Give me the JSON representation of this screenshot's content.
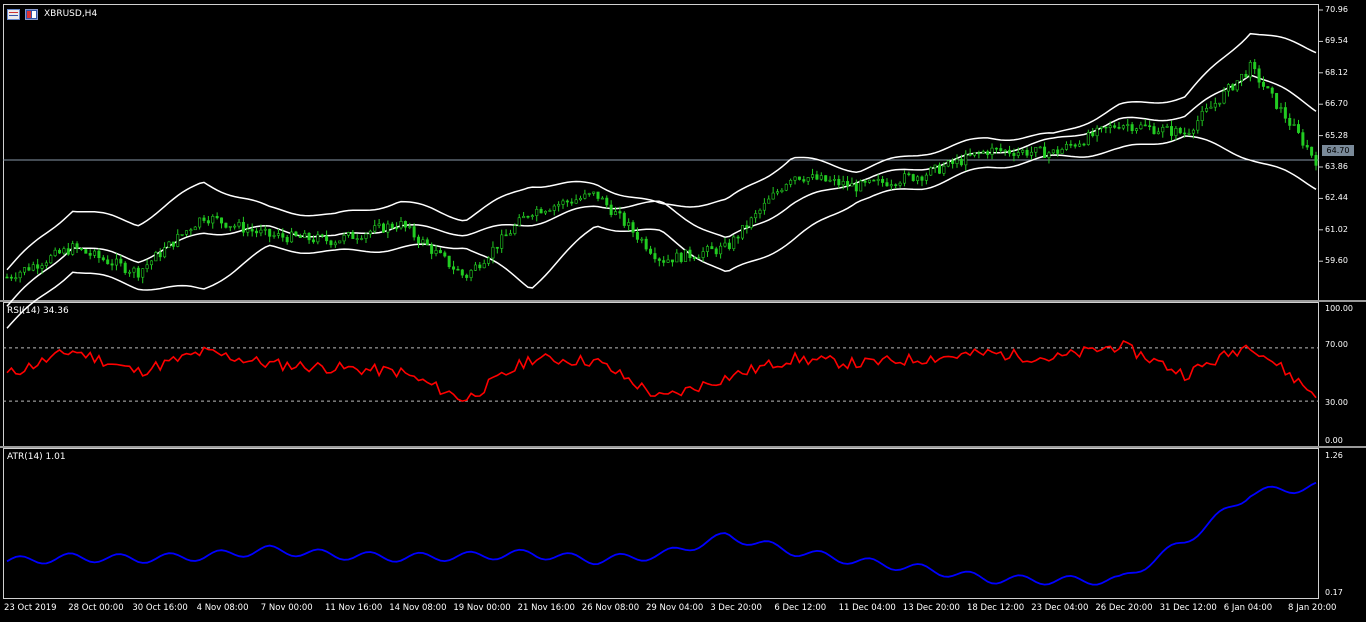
{
  "window": {
    "title": "XBRUSD,H4",
    "symbol": "XBRUSD",
    "timeframe": "H4"
  },
  "price_axis": [
    "70.96",
    "69.54",
    "68.12",
    "66.70",
    "65.28",
    "63.86",
    "62.44",
    "61.02",
    "59.60"
  ],
  "current_price": "64.70",
  "rsi": {
    "label": "RSI(14) 34.36",
    "levels": [
      "100.00",
      "70.00",
      "30.00",
      "0.00"
    ]
  },
  "atr": {
    "label": "ATR(14) 1.01",
    "levels": [
      "1.26",
      "0.17"
    ]
  },
  "time_axis": [
    "23 Oct 2019",
    "28 Oct 00:00",
    "30 Oct 16:00",
    "4 Nov 08:00",
    "7 Nov 00:00",
    "11 Nov 16:00",
    "14 Nov 08:00",
    "19 Nov 00:00",
    "21 Nov 16:00",
    "26 Nov 08:00",
    "29 Nov 04:00",
    "3 Dec 20:00",
    "6 Dec 12:00",
    "11 Dec 04:00",
    "13 Dec 20:00",
    "18 Dec 12:00",
    "23 Dec 04:00",
    "26 Dec 20:00",
    "31 Dec 12:00",
    "6 Jan 04:00",
    "8 Jan 20:00"
  ],
  "colors": {
    "background": "#000000",
    "bull_candle": "#22cc22",
    "bands": "#ffffff",
    "rsi": "#ff0000",
    "atr": "#0000ff",
    "grid": "#d0d0d0"
  },
  "icons": [
    "chart-window-icon",
    "symbol-flag-icon"
  ],
  "chart_data": [
    {
      "type": "candlestick",
      "title": "XBRUSD,H4",
      "overlay": "Bollinger Bands",
      "ylim": [
        59.0,
        71.1
      ],
      "x": [
        "23 Oct 2019",
        "28 Oct 00:00",
        "30 Oct 16:00",
        "4 Nov 08:00",
        "7 Nov 00:00",
        "11 Nov 16:00",
        "14 Nov 08:00",
        "19 Nov 00:00",
        "21 Nov 16:00",
        "26 Nov 08:00",
        "29 Nov 04:00",
        "3 Dec 20:00",
        "6 Dec 12:00",
        "11 Dec 04:00",
        "13 Dec 20:00",
        "18 Dec 12:00",
        "23 Dec 04:00",
        "26 Dec 20:00",
        "31 Dec 12:00",
        "6 Jan 04:00",
        "8 Jan 20:00"
      ],
      "close": [
        59.9,
        61.1,
        60.1,
        62.4,
        61.6,
        61.4,
        62.1,
        59.9,
        62.6,
        63.3,
        60.6,
        61.1,
        64.1,
        63.6,
        64.1,
        65.1,
        65.0,
        66.2,
        65.8,
        68.5,
        64.7
      ],
      "upper_band": [
        60.2,
        62.7,
        62.1,
        63.8,
        62.7,
        62.4,
        63.0,
        62.3,
        63.7,
        63.7,
        62.8,
        63.0,
        64.8,
        64.3,
        65.0,
        65.6,
        65.7,
        66.9,
        67.3,
        70.0,
        69.2
      ],
      "middle_band": [
        58.7,
        61.2,
        60.6,
        61.7,
        61.9,
        61.5,
        62.0,
        61.7,
        62.1,
        62.8,
        62.9,
        61.4,
        62.9,
        63.9,
        64.4,
        65.0,
        65.5,
        66.3,
        66.5,
        68.3,
        66.8
      ],
      "lower_band": [
        57.8,
        60.2,
        59.5,
        59.4,
        61.1,
        60.9,
        61.1,
        61.2,
        59.5,
        62.0,
        61.7,
        60.0,
        61.4,
        63.1,
        63.6,
        64.4,
        64.8,
        65.1,
        65.7,
        64.8,
        63.6
      ],
      "current_price": 64.7
    },
    {
      "type": "line",
      "title": "RSI(14) 34.36",
      "ylim": [
        0,
        100
      ],
      "levels": [
        30,
        70
      ],
      "x": [
        "23 Oct 2019",
        "28 Oct 00:00",
        "30 Oct 16:00",
        "4 Nov 08:00",
        "7 Nov 00:00",
        "11 Nov 16:00",
        "14 Nov 08:00",
        "19 Nov 00:00",
        "21 Nov 16:00",
        "26 Nov 08:00",
        "29 Nov 04:00",
        "3 Dec 20:00",
        "6 Dec 12:00",
        "11 Dec 04:00",
        "13 Dec 20:00",
        "18 Dec 12:00",
        "23 Dec 04:00",
        "26 Dec 20:00",
        "31 Dec 12:00",
        "6 Jan 04:00",
        "8 Jan 20:00"
      ],
      "series": [
        {
          "values": [
            50,
            68,
            52,
            67,
            58,
            55,
            52,
            31,
            62,
            60,
            32,
            48,
            62,
            58,
            62,
            66,
            62,
            72,
            50,
            73,
            34.36
          ]
        }
      ]
    },
    {
      "type": "line",
      "title": "ATR(14) 1.01",
      "ylim": [
        0.17,
        1.26
      ],
      "x": [
        "23 Oct 2019",
        "28 Oct 00:00",
        "30 Oct 16:00",
        "4 Nov 08:00",
        "7 Nov 00:00",
        "11 Nov 16:00",
        "14 Nov 08:00",
        "19 Nov 00:00",
        "21 Nov 16:00",
        "26 Nov 08:00",
        "29 Nov 04:00",
        "3 Dec 20:00",
        "6 Dec 12:00",
        "11 Dec 04:00",
        "13 Dec 20:00",
        "18 Dec 12:00",
        "23 Dec 04:00",
        "26 Dec 20:00",
        "31 Dec 12:00",
        "6 Jan 04:00",
        "8 Jan 20:00"
      ],
      "series": [
        {
          "values": [
            0.42,
            0.45,
            0.44,
            0.46,
            0.51,
            0.47,
            0.45,
            0.46,
            0.48,
            0.43,
            0.47,
            0.62,
            0.5,
            0.42,
            0.36,
            0.28,
            0.27,
            0.27,
            0.58,
            0.96,
            1.01
          ]
        }
      ]
    }
  ]
}
